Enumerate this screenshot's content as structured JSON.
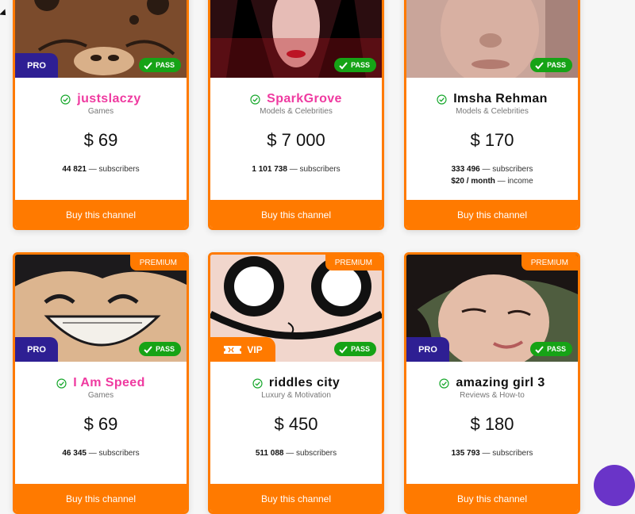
{
  "cards": [
    {
      "name": "justslaczy",
      "category": "Games",
      "price": "$ 69",
      "subscribers": "44 821",
      "subscribers_label": "— subscribers",
      "badge_left": "PRO",
      "badge_pass": "PASS",
      "badge_premium": "",
      "income": "",
      "income_label": "",
      "button": "Buy this channel"
    },
    {
      "name": "SparkGrove",
      "category": "Models & Celebrities",
      "price": "$ 7 000",
      "subscribers": "1 101 738",
      "subscribers_label": "— subscribers",
      "badge_left": "",
      "badge_pass": "PASS",
      "badge_premium": "",
      "income": "",
      "income_label": "",
      "button": "Buy this channel"
    },
    {
      "name": "Imsha Rehman",
      "category": "Models & Celebrities",
      "price": "$ 170",
      "subscribers": "333 496",
      "subscribers_label": "— subscribers",
      "badge_left": "",
      "badge_pass": "PASS",
      "badge_premium": "",
      "income": "$20 / month",
      "income_label": "— income",
      "button": "Buy this channel"
    },
    {
      "name": "I Am Speed",
      "category": "Games",
      "price": "$ 69",
      "subscribers": "46 345",
      "subscribers_label": "— subscribers",
      "badge_left": "PRO",
      "badge_pass": "PASS",
      "badge_premium": "PREMIUM",
      "income": "",
      "income_label": "",
      "button": "Buy this channel"
    },
    {
      "name": "riddles city",
      "category": "Luxury & Motivation",
      "price": "$ 450",
      "subscribers": "511 088",
      "subscribers_label": "— subscribers",
      "badge_left": "VIP",
      "badge_pass": "PASS",
      "badge_premium": "PREMIUM",
      "income": "",
      "income_label": "",
      "button": "Buy this channel"
    },
    {
      "name": "amazing girl 3",
      "category": "Reviews & How-to",
      "price": "$ 180",
      "subscribers": "135 793",
      "subscribers_label": "— subscribers",
      "badge_left": "PRO",
      "badge_pass": "PASS",
      "badge_premium": "PREMIUM",
      "income": "",
      "income_label": "",
      "button": "Buy this channel"
    }
  ],
  "colors": {
    "accent": "#ff7a00",
    "pro": "#2e1f93",
    "pass": "#16a316",
    "name_pink": "#ef3aa0",
    "fab": "#6a34c8"
  },
  "icons": [
    "verified-check-icon",
    "check-icon",
    "ticket-icon",
    "cursor-icon"
  ]
}
